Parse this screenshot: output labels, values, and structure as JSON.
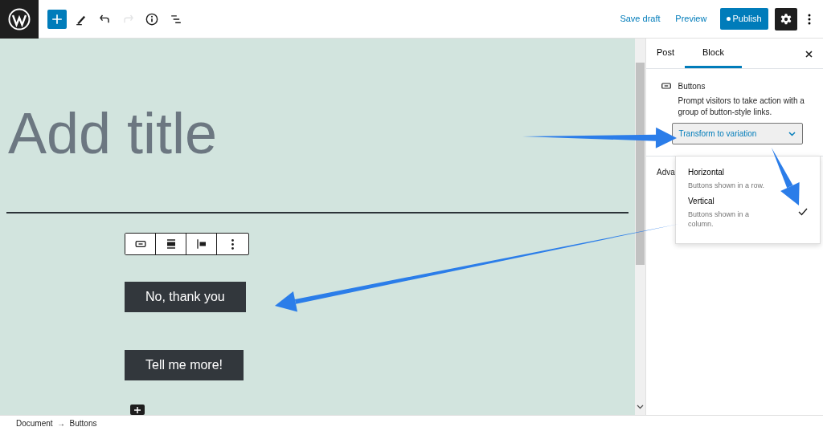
{
  "toolbar": {
    "items": [
      {
        "kind": "add",
        "disabled": false
      },
      {
        "kind": "edit",
        "disabled": false
      },
      {
        "kind": "undo",
        "disabled": false
      },
      {
        "kind": "redo",
        "disabled": true
      },
      {
        "kind": "info",
        "disabled": false
      },
      {
        "kind": "outline",
        "disabled": false
      }
    ],
    "actions": [
      {
        "kind": "link",
        "label": "Save draft"
      },
      {
        "kind": "link",
        "label": "Preview"
      },
      {
        "kind": "primary",
        "label": "Publish"
      }
    ]
  },
  "editor": {
    "title_placeholder": "Add title",
    "block_toolbar": [
      {
        "kind": "block"
      },
      {
        "kind": "justify"
      },
      {
        "kind": "align"
      },
      {
        "kind": "more"
      }
    ],
    "buttons": [
      {
        "label": "No, thank you"
      },
      {
        "label": "Tell me more!"
      }
    ]
  },
  "sidebar": {
    "tabs": [
      {
        "label": "Post",
        "selected": false
      },
      {
        "label": "Block",
        "selected": true
      }
    ],
    "block": {
      "name": "Buttons",
      "description": "Prompt visitors to take action with a group of button-style links."
    },
    "variation_select": {
      "value": "Transform to variation"
    },
    "variation_options": [
      {
        "label": "Horizontal",
        "description": "Buttons shown in a row.",
        "selected": false
      },
      {
        "label": "Vertical",
        "description": "Buttons shown in a column.",
        "selected": true
      }
    ],
    "section_label": "Adva"
  },
  "breadcrumb": [
    "Document",
    "→",
    "Buttons"
  ]
}
